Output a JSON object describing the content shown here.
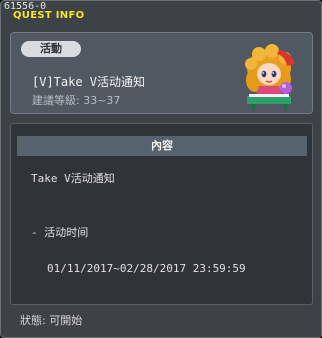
{
  "header": {
    "quest_id": "61556-0",
    "title": "QUEST INFO"
  },
  "quest": {
    "tag": "活動",
    "name": "[V]Take V活动通知",
    "level_requirement": "建議等級: 33~37"
  },
  "content": {
    "header": "內容",
    "line1": "Take V活动通知",
    "line2": "- 活动时间",
    "line3": "01/11/2017~02/28/2017 23:59:59"
  },
  "footer": {
    "status": "狀態: 可開始"
  },
  "npc": {
    "icon": "npc-girl-portrait"
  },
  "colors": {
    "title": "#f5e52a",
    "window_bg": "#3d4247"
  }
}
